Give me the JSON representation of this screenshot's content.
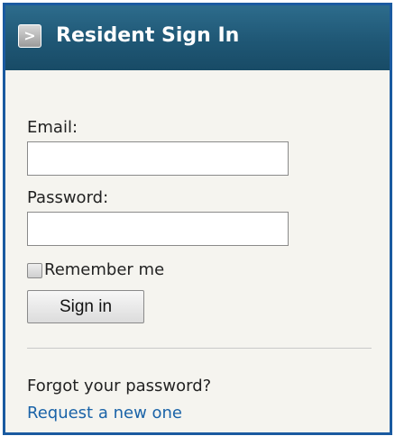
{
  "header": {
    "toggle_icon": "chevron-right-icon",
    "toggle_glyph": ">",
    "title": "Resident Sign In",
    "background_color": "#1f5775"
  },
  "form": {
    "email_label": "Email:",
    "email_value": "",
    "password_label": "Password:",
    "password_value": "",
    "remember_label": "Remember me",
    "remember_checked": false,
    "signin_label": "Sign in"
  },
  "footer": {
    "forgot_text": "Forgot your password?",
    "request_link": "Request a new one",
    "link_color": "#1a63a8"
  },
  "colors": {
    "border": "#1a5aa0",
    "panel_background": "#f5f4ef"
  }
}
